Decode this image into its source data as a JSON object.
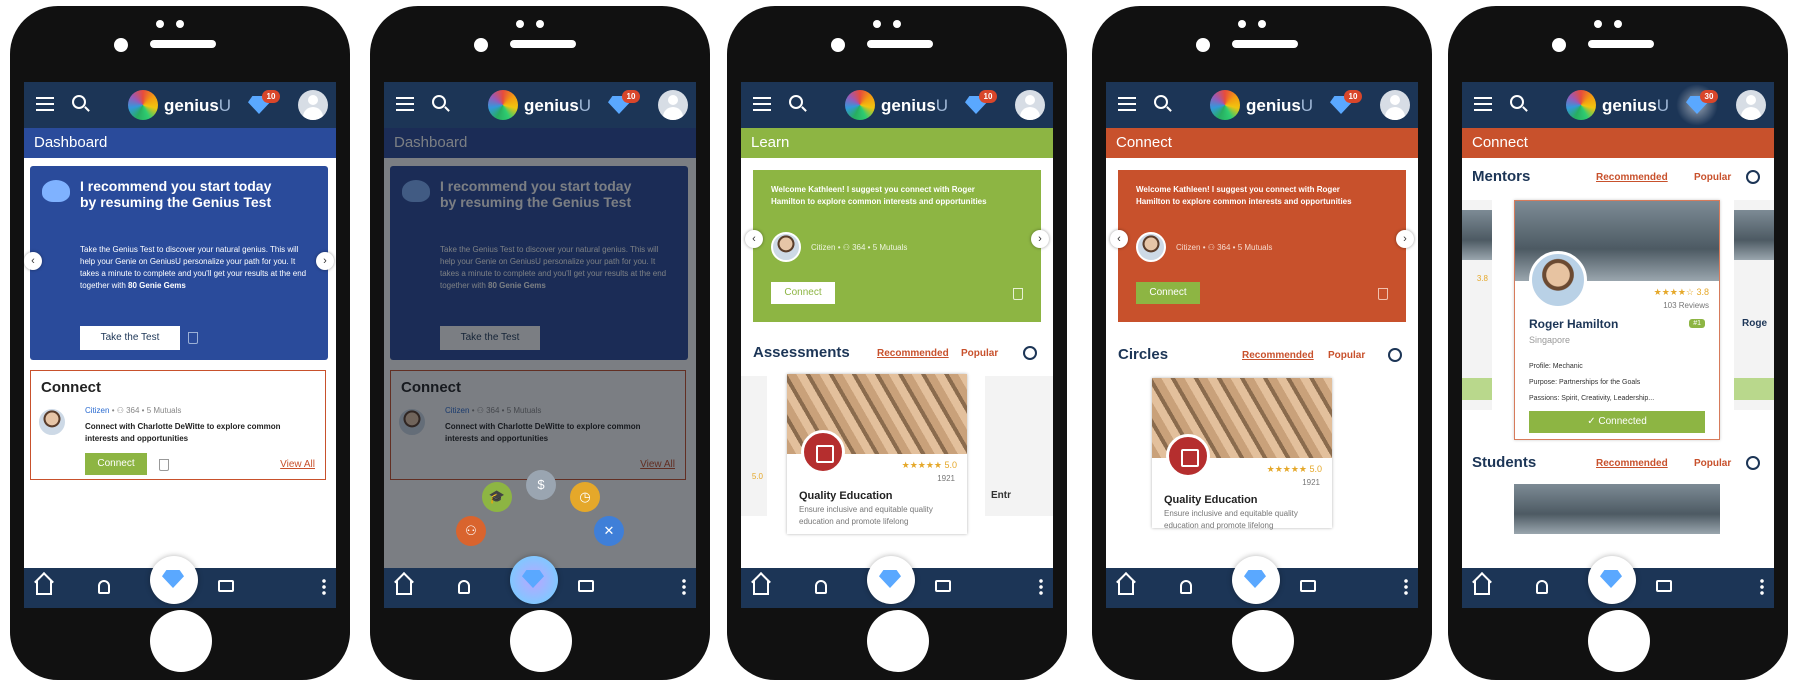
{
  "header": {
    "logo_main": "genius",
    "logo_suffix": "U",
    "gems": "10",
    "gems_alt": "30"
  },
  "screens": {
    "dashboard": {
      "title": "Dashboard",
      "banner_heading": "I recommend you start today by resuming the Genius Test",
      "banner_body": "Take the Genius Test to discover your natural genius. This will help your Genie on GeniusU personalize your path for you. It takes a minute to complete and you'll get your results at the end together with",
      "banner_gems": "80 Genie Gems",
      "banner_button": "Take the Test",
      "connect_title": "Connect",
      "connect_role": "Citizen",
      "connect_meta": "• ⚇ 364 • 5 Mutuals",
      "connect_text": "Connect with Charlotte DeWitte to explore common interests and opportunities",
      "connect_button": "Connect",
      "view_all": "View All"
    },
    "learn": {
      "title": "Learn",
      "suggest": "Welcome Kathleen! I suggest you connect with Roger Hamilton to explore common interests and opportunities",
      "role": "Citizen",
      "meta": "• ⚇ 364 • 5 Mutuals",
      "connect_button": "Connect",
      "section": "Assessments",
      "tab_recommended": "Recommended",
      "tab_popular": "Popular",
      "card_title": "Quality Education",
      "card_text": "Ensure inclusive and equitable quality education and promote lifelong",
      "rating": "5.0",
      "rating_count": "1921",
      "side_left_rating": "5.0",
      "side_right_label": "Entr"
    },
    "connect": {
      "title": "Connect",
      "section": "Circles",
      "suggest": "Welcome Kathleen! I suggest you connect with Roger Hamilton to explore common interests and opportunities",
      "role": "Citizen",
      "meta": "• ⚇ 364 • 5 Mutuals",
      "connect_button": "Connect",
      "tab_recommended": "Recommended",
      "tab_popular": "Popular",
      "card_title": "Quality Education",
      "card_text": "Ensure inclusive and equitable quality education and promote lifelong",
      "rating": "5.0",
      "rating_count": "1921"
    },
    "mentors": {
      "title": "Connect",
      "section": "Mentors",
      "tab_recommended": "Recommended",
      "tab_popular": "Popular",
      "name": "Roger Hamilton",
      "location": "Singapore",
      "rating": "3.8",
      "reviews": "103 Reviews",
      "rank": "#1",
      "profile": "Profile: Mechanic",
      "purpose": "Purpose: Partnerships for the Goals",
      "passions": "Passions: Spirit, Creativity, Leadership...",
      "connected": "✓ Connected",
      "left_rating": "3.8",
      "right_name": "Roge",
      "students": "Students"
    }
  },
  "colors": {
    "navy": "#1c3556",
    "blue": "#2a4b9b",
    "green": "#8db543",
    "orange": "#c8512c",
    "red": "#b52e2e"
  },
  "icons": [
    "menu-icon",
    "search-icon",
    "gem-icon",
    "avatar-icon",
    "home-icon",
    "bell-icon",
    "chat-icon",
    "more-icon",
    "trash-icon"
  ]
}
